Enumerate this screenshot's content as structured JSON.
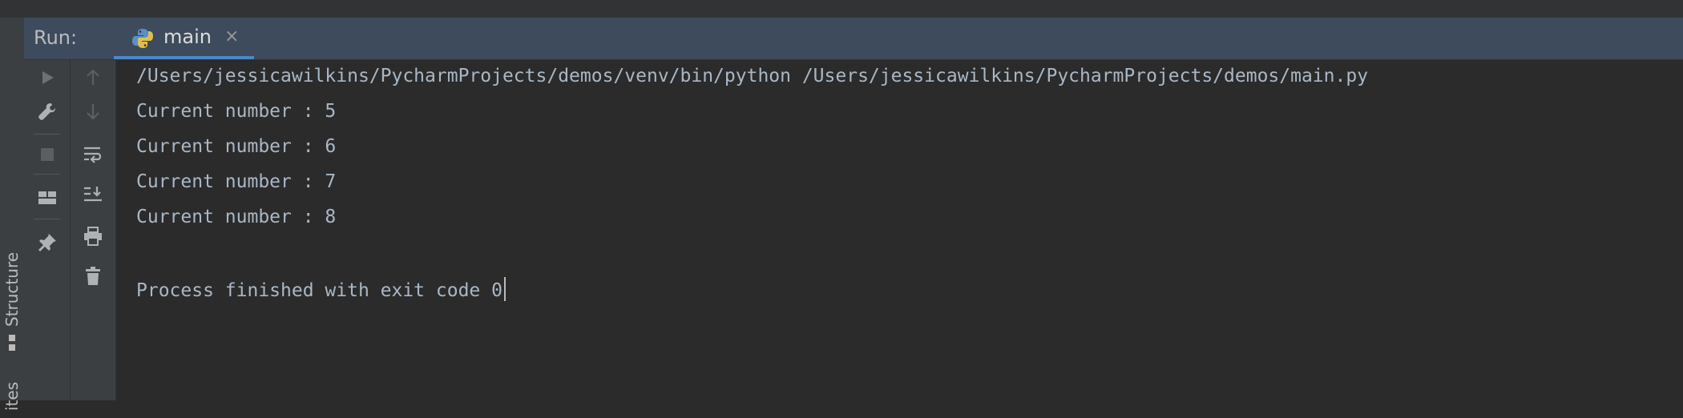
{
  "run_panel": {
    "label": "Run:",
    "tab": {
      "label": "main",
      "icon": "python-icon",
      "close_symbol": "×"
    }
  },
  "left_sidebar": {
    "structure_label": "Structure",
    "bottom_label": "ites"
  },
  "toolbar": {
    "left": [
      "run-icon",
      "wrench-icon",
      "stop-icon",
      "layout-icon",
      "pin-icon"
    ],
    "right": [
      "up-arrow-icon",
      "down-arrow-icon",
      "soft-wrap-icon",
      "scroll-to-end-icon",
      "print-icon",
      "trash-icon"
    ]
  },
  "console": {
    "lines": [
      "/Users/jessicawilkins/PycharmProjects/demos/venv/bin/python /Users/jessicawilkins/PycharmProjects/demos/main.py",
      "Current number : 5",
      "Current number : 6",
      "Current number : 7",
      "Current number : 8",
      "",
      "Process finished with exit code 0"
    ]
  },
  "colors": {
    "console_bg": "#2b2b2b",
    "toolbar_bg": "#3c3f41",
    "run_bar_bg": "#3d4b5c",
    "text": "#a9b7c6",
    "tab_underline": "#4a88c7"
  }
}
